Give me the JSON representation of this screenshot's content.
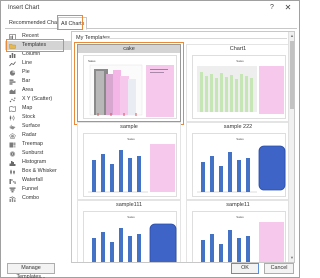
{
  "window": {
    "title": "Insert Chart",
    "help_icon": "?",
    "close_icon": "✕"
  },
  "tabs": [
    {
      "label": "Recommended Charts"
    },
    {
      "label": "All Charts",
      "selected": true
    }
  ],
  "sidebar": {
    "items": [
      {
        "label": "Recent",
        "icon": "recent-icon"
      },
      {
        "label": "Templates",
        "icon": "folder-icon",
        "selected": true
      },
      {
        "label": "Column",
        "icon": "column-chart-icon"
      },
      {
        "label": "Line",
        "icon": "line-chart-icon"
      },
      {
        "label": "Pie",
        "icon": "pie-chart-icon"
      },
      {
        "label": "Bar",
        "icon": "bar-chart-icon"
      },
      {
        "label": "Area",
        "icon": "area-chart-icon"
      },
      {
        "label": "X Y (Scatter)",
        "icon": "scatter-chart-icon"
      },
      {
        "label": "Map",
        "icon": "map-chart-icon"
      },
      {
        "label": "Stock",
        "icon": "stock-chart-icon"
      },
      {
        "label": "Surface",
        "icon": "surface-chart-icon"
      },
      {
        "label": "Radar",
        "icon": "radar-chart-icon"
      },
      {
        "label": "Treemap",
        "icon": "treemap-chart-icon"
      },
      {
        "label": "Sunburst",
        "icon": "sunburst-chart-icon"
      },
      {
        "label": "Histogram",
        "icon": "histogram-chart-icon"
      },
      {
        "label": "Box & Whisker",
        "icon": "box-whisker-chart-icon"
      },
      {
        "label": "Waterfall",
        "icon": "waterfall-chart-icon"
      },
      {
        "label": "Funnel",
        "icon": "funnel-chart-icon"
      },
      {
        "label": "Combo",
        "icon": "combo-chart-icon"
      }
    ]
  },
  "main": {
    "section_title": "My Templates",
    "templates": [
      {
        "name": "cake",
        "selected": true
      },
      {
        "name": "Chart1"
      },
      {
        "name": "sample"
      },
      {
        "name": "sample 222"
      },
      {
        "name": "sample111"
      },
      {
        "name": "sample11"
      }
    ]
  },
  "footer": {
    "manage_label": "Manage Templates...",
    "ok_label": "OK",
    "cancel_label": "Cancel"
  },
  "colors": {
    "accent_highlight": "#e88a3c",
    "bar_blue": "#4472c4",
    "pink": "#f6c9ec"
  }
}
